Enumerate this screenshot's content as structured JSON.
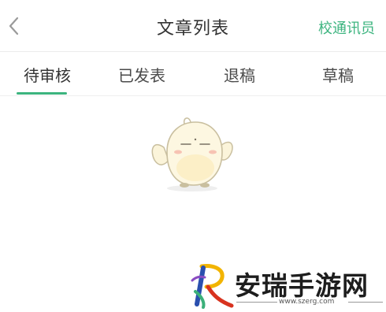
{
  "header": {
    "title": "文章列表",
    "action_label": "校通讯员",
    "back_icon": "chevron-left-icon"
  },
  "tabs": [
    {
      "label": "待审核",
      "active": true
    },
    {
      "label": "已发表",
      "active": false
    },
    {
      "label": "退稿",
      "active": false
    },
    {
      "label": "草稿",
      "active": false
    }
  ],
  "empty_state": {
    "illustration": "bird-mascot-illustration"
  },
  "watermark": {
    "name": "安瑞手游网",
    "url": "www.szerg.com"
  },
  "colors": {
    "accent": "#3cb47f",
    "title_text": "#333333",
    "tab_text": "#4a4a4a"
  }
}
